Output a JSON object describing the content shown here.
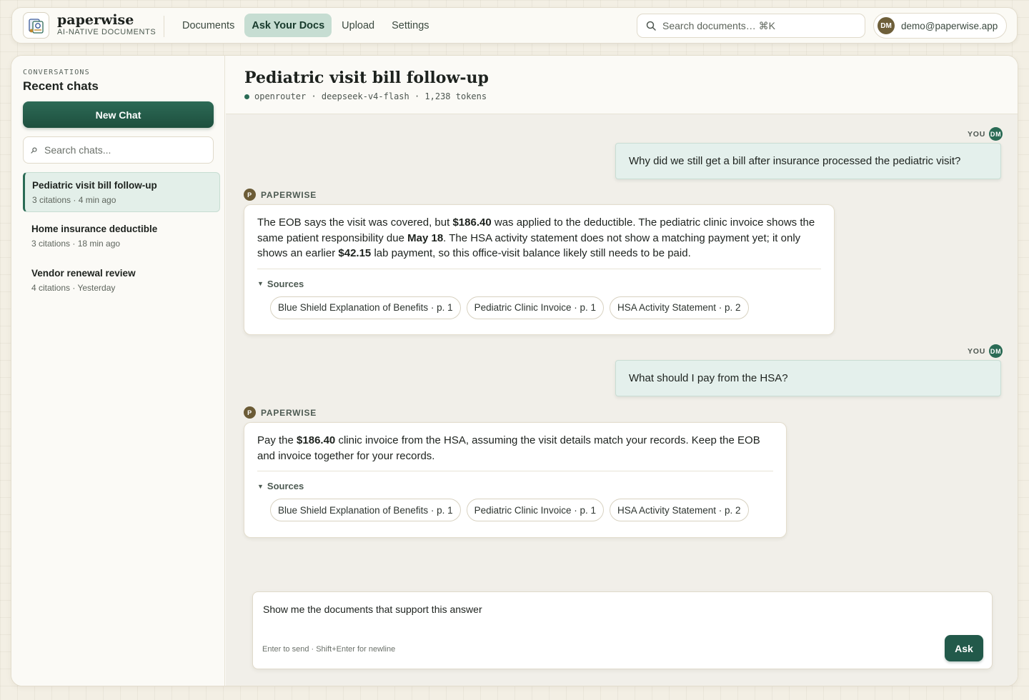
{
  "brand": {
    "name": "paperwise",
    "tagline": "AI-NATIVE DOCUMENTS",
    "logo_icon": "app-logo-icon"
  },
  "nav": {
    "items": [
      {
        "label": "Documents",
        "active": false
      },
      {
        "label": "Ask Your Docs",
        "active": true
      },
      {
        "label": "Upload",
        "active": false
      },
      {
        "label": "Settings",
        "active": false
      }
    ],
    "search_placeholder": "Search documents… ⌘K",
    "search_icon": "search-icon"
  },
  "user": {
    "initials": "DM",
    "email": "demo@paperwise.app"
  },
  "sidebar": {
    "eyebrow": "CONVERSATIONS",
    "title": "Recent chats",
    "new_chat_label": "New Chat",
    "search_placeholder": "Search chats...",
    "chats": [
      {
        "title": "Pediatric visit bill follow-up",
        "meta": "3 citations · 4 min ago",
        "active": true
      },
      {
        "title": "Home insurance deductible",
        "meta": "3 citations · 18 min ago",
        "active": false
      },
      {
        "title": "Vendor renewal review",
        "meta": "4 citations · Yesterday",
        "active": false
      }
    ]
  },
  "chat": {
    "title": "Pediatric visit bill follow-up",
    "model_line": "openrouter · deepseek-v4-flash · 1,238 tokens",
    "you_label": "YOU",
    "you_initials": "DM",
    "assistant_label": "PAPERWISE",
    "assistant_initial": "P",
    "sources_label": "Sources",
    "messages": [
      {
        "role": "user",
        "text": "Why did we still get a bill after insurance processed the pediatric visit?"
      },
      {
        "role": "assistant",
        "parts": [
          {
            "t": "The EOB says the visit was covered, but "
          },
          {
            "t": "$186.40",
            "b": true
          },
          {
            "t": " was applied to the deductible. The pediatric clinic invoice shows the same patient responsibility due "
          },
          {
            "t": "May 18",
            "b": true
          },
          {
            "t": ". The HSA activity statement does not show a matching payment yet; it only shows an earlier "
          },
          {
            "t": "$42.15",
            "b": true
          },
          {
            "t": " lab payment, so this office-visit balance likely still needs to be paid."
          }
        ],
        "sources": [
          "Blue Shield Explanation of Benefits · p. 1",
          "Pediatric Clinic Invoice · p. 1",
          "HSA Activity Statement · p. 2"
        ]
      },
      {
        "role": "user",
        "text": "What should I pay from the HSA?"
      },
      {
        "role": "assistant",
        "parts": [
          {
            "t": "Pay the "
          },
          {
            "t": "$186.40",
            "b": true
          },
          {
            "t": " clinic invoice from the HSA, assuming the visit details match your records. Keep the EOB and invoice together for your records."
          }
        ],
        "sources": [
          "Blue Shield Explanation of Benefits · p. 1",
          "Pediatric Clinic Invoice · p. 1",
          "HSA Activity Statement · p. 2"
        ]
      }
    ]
  },
  "composer": {
    "value": "Show me the documents that support this answer",
    "hint": "Enter to send · Shift+Enter for newline",
    "ask_label": "Ask"
  },
  "colors": {
    "accent": "#22594a",
    "accent_light": "#c6ddd2",
    "user_bubble": "#e4f0ec",
    "page_bg": "#f3efe4"
  }
}
